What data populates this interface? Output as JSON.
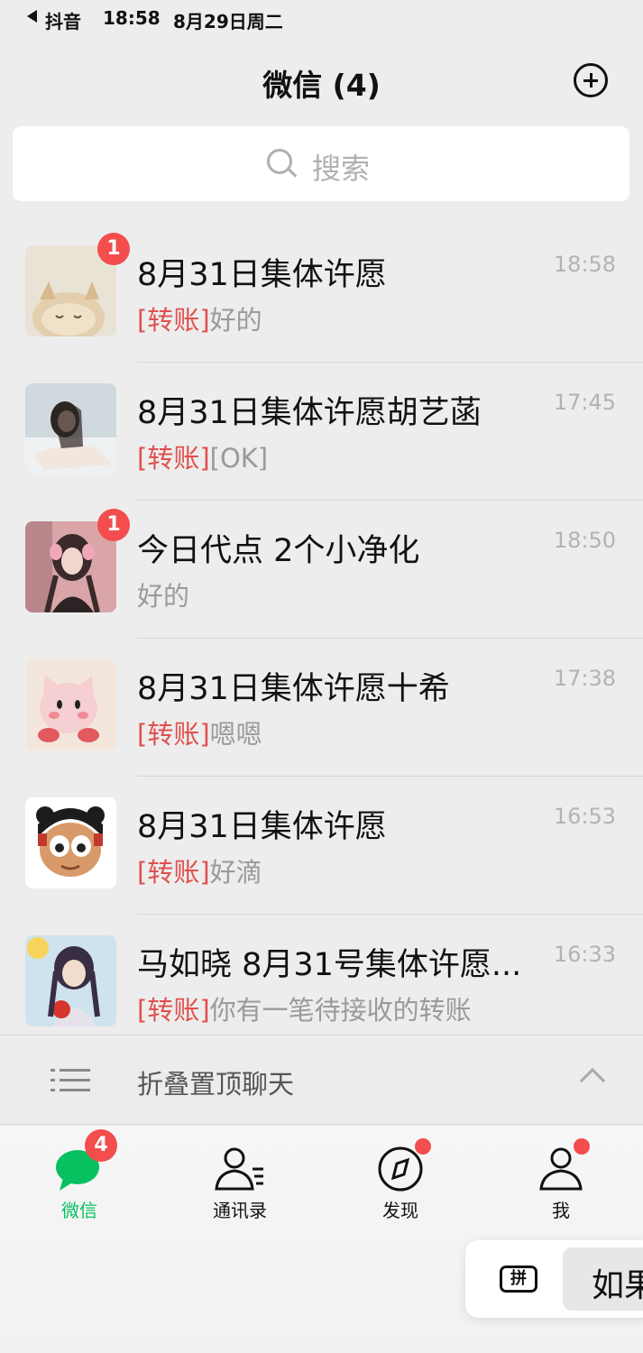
{
  "status_bar": {
    "app": "抖音",
    "time": "18:58",
    "date": "8月29日周二"
  },
  "header": {
    "title": "微信 (4)"
  },
  "search": {
    "placeholder": "搜索"
  },
  "chats": [
    {
      "name": "8月31日集体许愿",
      "tag": "[转账]",
      "message": "好的",
      "time": "18:58",
      "badge": "1"
    },
    {
      "name": "8月31日集体许愿胡艺菡",
      "tag": "[转账]",
      "message": "[OK]",
      "time": "17:45",
      "badge": ""
    },
    {
      "name": "今日代点 2个小净化",
      "tag": "",
      "message": "好的",
      "time": "18:50",
      "badge": "1"
    },
    {
      "name": "8月31日集体许愿十希",
      "tag": "[转账]",
      "message": "嗯嗯",
      "time": "17:38",
      "badge": ""
    },
    {
      "name": "8月31日集体许愿",
      "tag": "[转账]",
      "message": "好滴",
      "time": "16:53",
      "badge": ""
    },
    {
      "name": "马如晓 8月31号集体许愿...",
      "tag": "[转账]",
      "message": "你有一笔待接收的转账",
      "time": "16:33",
      "badge": ""
    }
  ],
  "fold": {
    "label": "折叠置顶聊天"
  },
  "tabbar": {
    "tabs": [
      {
        "label": "微信",
        "badge": "4"
      },
      {
        "label": "通讯录"
      },
      {
        "label": "发现"
      },
      {
        "label": "我"
      }
    ]
  },
  "ime": {
    "keyboard_label": "拼",
    "candidate": "如果"
  },
  "colors": {
    "accent": "#07c160",
    "badge": "#f34d4d",
    "transfer_tag": "#e0504e"
  }
}
